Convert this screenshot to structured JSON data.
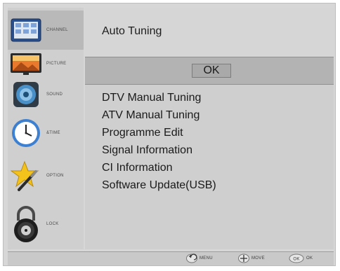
{
  "sidebar": {
    "items": [
      {
        "label": "CHANNEL",
        "icon": "channel-icon",
        "active": true
      },
      {
        "label": "PICTURE",
        "icon": "picture-icon",
        "active": false
      },
      {
        "label": "SOUND",
        "icon": "sound-icon",
        "active": false
      },
      {
        "label": "&TIME",
        "icon": "clock-icon",
        "active": false
      },
      {
        "label": "OPTION",
        "icon": "option-icon",
        "active": false
      },
      {
        "label": "LOCK",
        "icon": "lock-icon",
        "active": false
      }
    ]
  },
  "main": {
    "title": "Auto Tuning",
    "ok_label": "OK",
    "menu_items": [
      "DTV Manual Tuning",
      "ATV Manual Tuning",
      "Programme Edit",
      "Signal Information",
      "CI Information",
      "Software Update(USB)"
    ]
  },
  "footer": {
    "hints": [
      {
        "label": "MENU",
        "icon": "back-arrow-icon"
      },
      {
        "label": "MOVE",
        "icon": "dpad-icon"
      },
      {
        "label": "OK",
        "icon": "ok-key-icon"
      }
    ]
  },
  "colors": {
    "panel": "#cfcfcf",
    "highlight": "#b3b3b3",
    "text": "#1a1a1a"
  }
}
